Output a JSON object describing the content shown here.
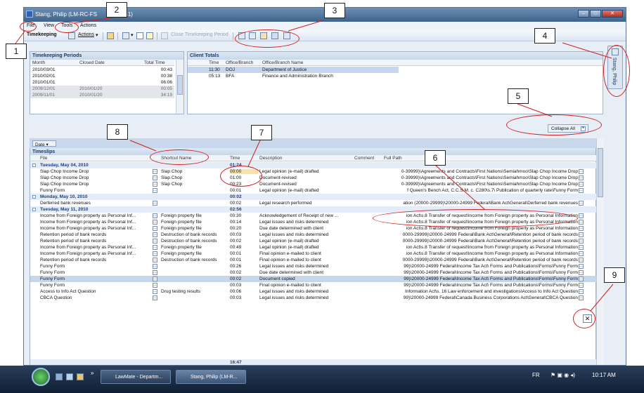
{
  "window": {
    "title": "Stang, Philip (LM-RC-FS",
    "title_tail": "l-pxs751)"
  },
  "menu": [
    "File",
    "View",
    "Tools",
    "Actions"
  ],
  "toolbar": {
    "timekeeping": "Timekeeping",
    "actions": "Actions",
    "close_period": "Close Timekeeping Period"
  },
  "periods": {
    "title": "Timekeeping Periods",
    "headers": [
      "Month",
      "Closed Date",
      "Total Time"
    ],
    "rows": [
      [
        "2010/03/01",
        "",
        "00:43"
      ],
      [
        "2010/02/01",
        "",
        "00:38"
      ],
      [
        "2010/01/01",
        "",
        "06:06"
      ],
      [
        "2009/12/01",
        "2010/01/20",
        "00:05"
      ],
      [
        "2009/11/01",
        "2010/01/20",
        "34:19"
      ]
    ]
  },
  "clients": {
    "title": "Client Totals",
    "headers": [
      "Time",
      "Office/Branch",
      "Office/Branch Name"
    ],
    "rows": [
      [
        "11:30",
        "DOJ",
        "Department of Justice"
      ],
      [
        "05:13",
        "BFA",
        "Finance and Administration Branch"
      ]
    ]
  },
  "side_tab": "Stang, Philip",
  "collapse_label": "Collapse All",
  "group_chip": "Date",
  "timeslips": {
    "title": "Timeslips",
    "headers": [
      "File",
      "Shortcut Name",
      "Time",
      "Description",
      "Comment",
      "Full Path"
    ],
    "groups": [
      {
        "date": "Tuesday, May 04, 2010",
        "total": "01:24",
        "rows": [
          [
            "Slap Chop Income Drop",
            "Slap Chop",
            "00:00",
            "Legal opinion (e-mail) drafted",
            "",
            "0-39999)\\Agreements and Contracts\\First Nations\\Semiahmoo\\Slap Chop Income Drop"
          ],
          [
            "Slap Chop Income Drop",
            "Slap Chop",
            "01:00",
            "Document-revised",
            "",
            "0-39999)\\Agreements and Contracts\\First Nations\\Semiahmoo\\Slap Chop Income Drop"
          ],
          [
            "Slap Chop Income Drop",
            "Slap Chop",
            "00:23",
            "Document-revised",
            "",
            "0-39999)\\Agreements and Contracts\\First Nations\\Semiahmoo\\Slap Chop Income Drop"
          ],
          [
            "Funny Form",
            "",
            "00:01",
            "Legal opinion (e-mail) drafted",
            "",
            "f Queen's Bench Act, C.C.S.M. c. C280\\s.7\\ Publication of quarterly rate\\Funny Form"
          ]
        ]
      },
      {
        "date": "Monday, May 10, 2010",
        "total": "00:02",
        "rows": [
          [
            "Derferred bank revenues",
            "",
            "00:02",
            "Legal research performed",
            "",
            "ation (20000-29999)\\20000-24999 Federal\\Bank Act\\General\\Derferred bank revenues"
          ]
        ]
      },
      {
        "date": "Tuesday, May 11, 2010",
        "total": "02:56",
        "rows": [
          [
            "Income from Foreign property as Personal Inf...",
            "Foreign property file",
            "00:30",
            "Acknowledgement of Receipt of new ...",
            "",
            "ion Act\\s.8 Transfer of request\\Income from Foreign property as Personal Information"
          ],
          [
            "Income from Foreign property as Personal Inf...",
            "Foreign property file",
            "00:14",
            "Legal issues and risks determined",
            "",
            "ion Act\\s.8 Transfer of request\\Income from Foreign property as Personal Information"
          ],
          [
            "Income from Foreign property as Personal Inf...",
            "Foreign property file",
            "00:20",
            "Due date determined with client",
            "",
            "ion Act\\s.8 Transfer of request\\Income from Foreign property as Personal Information"
          ],
          [
            "Retention period of bank records",
            "Destruction of bank records",
            "00:03",
            "Legal issues and risks determined",
            "",
            "0000-29999)\\20000-24999 Federal\\Bank Act\\General\\Retention period of bank records"
          ],
          [
            "Retention period of bank records",
            "Destruction of bank records",
            "00:02",
            "Legal opinion (e-mail) drafted",
            "",
            "0000-29999)\\20000-24999 Federal\\Bank Act\\General\\Retention period of bank records"
          ],
          [
            "Income from Foreign property as Personal Inf...",
            "Foreign property file",
            "00:49",
            "Legal opinion (e-mail) drafted",
            "",
            "ion Act\\s.8 Transfer of request\\Income from Foreign property as Personal Information"
          ],
          [
            "Income from Foreign property as Personal Inf...",
            "Foreign property file",
            "00:01",
            "Final opinion e-mailed to client",
            "",
            "ion Act\\s.8 Transfer of request\\Income from Foreign property as Personal Information"
          ],
          [
            "Retention period of bank records",
            "Destruction of bank records",
            "00:01",
            "Final opinion e-mailed to client",
            "",
            "0000-29999)\\20000-24999 Federal\\Bank Act\\General\\Retention period of bank records"
          ],
          [
            "Funny Form",
            "",
            "00:26",
            "Legal issues and risks determined",
            "",
            "99)\\20000-24999 Federal\\Income Tax Act\\ Forms and Publications\\Forms\\Funny Form"
          ],
          [
            "Funny Form",
            "",
            "00:02",
            "Due date determined with client",
            "",
            "99)\\20000-24999 Federal\\Income Tax Act\\ Forms and Publications\\Forms\\Funny Form"
          ],
          [
            "Funny Form",
            "",
            "00:02",
            "Document copied",
            "",
            "99)\\20000-24999 Federal\\Income Tax Act\\ Forms and Publications\\Forms\\Funny Form"
          ],
          [
            "Funny Form",
            "",
            "00:03",
            "Final opinion e-mailed to client",
            "",
            "99)\\20000-24999 Federal\\Income Tax Act\\ Forms and Publications\\Forms\\Funny Form"
          ],
          [
            "Access to Info Act Question",
            "Drug testing results",
            "00:06",
            "Legal issues and risks determined",
            "",
            "Information Act\\s. 16 Law enforcement and investigations\\Access to Info Act Question"
          ],
          [
            "CBCA Question",
            "",
            "00:03",
            "Legal issues and risks determined",
            "",
            "99)\\20000-24999 Federal\\Canada Business Corporations Act\\General\\CBCA Question"
          ]
        ]
      }
    ],
    "grand_total": "16:47"
  },
  "taskbar": {
    "task1": "LawMate - Departm...",
    "task2": "Stang, Philip (LM-R...",
    "lang": "FR",
    "clock": "10:17 AM"
  },
  "callouts": [
    "1",
    "2",
    "3",
    "4",
    "5",
    "6",
    "7",
    "8",
    "9"
  ]
}
